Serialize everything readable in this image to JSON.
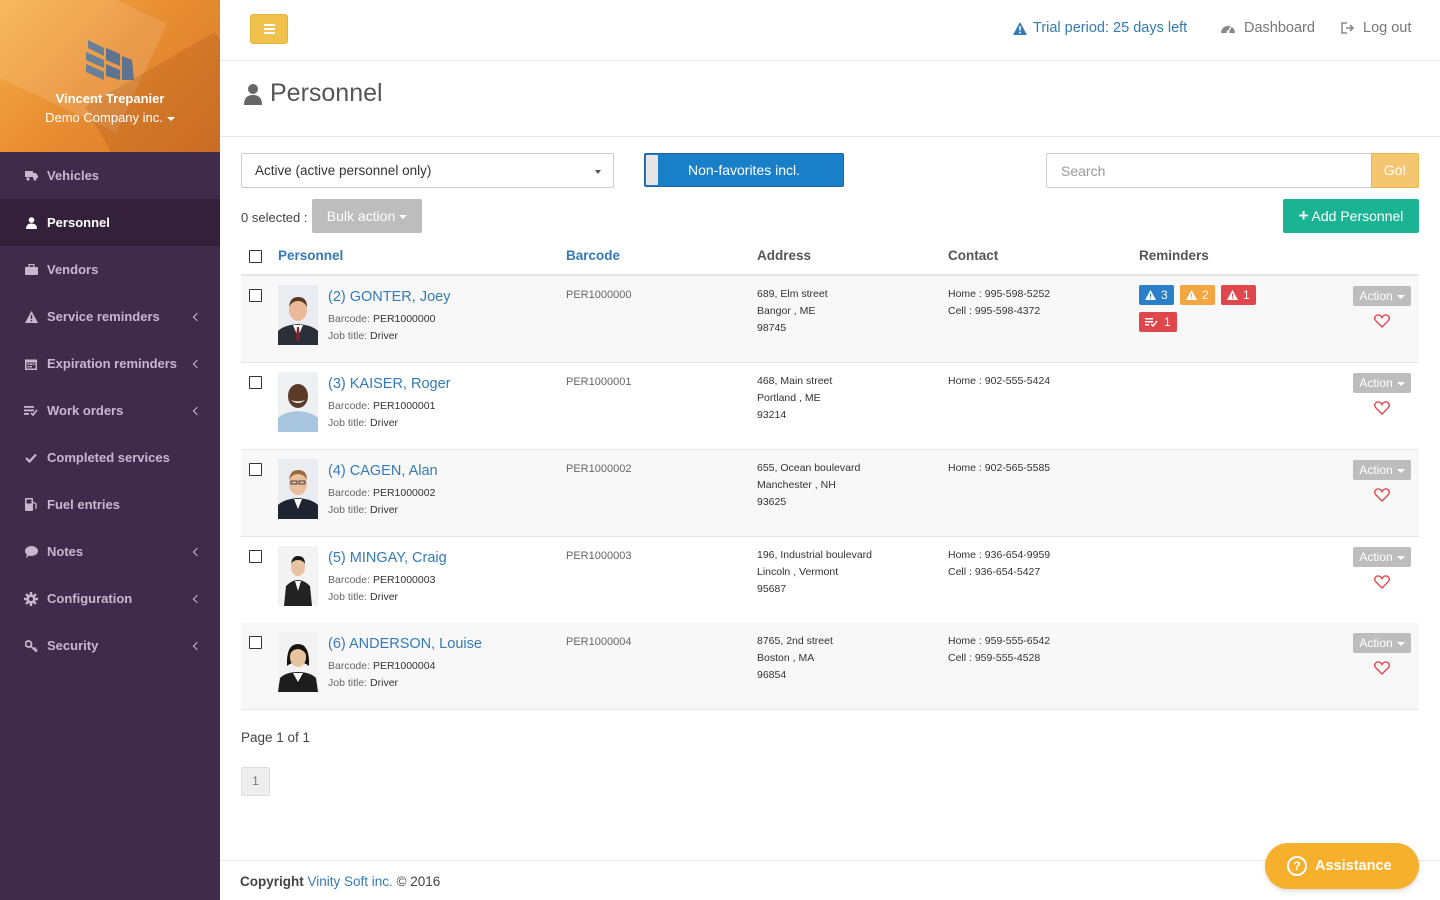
{
  "sidebar": {
    "user_name": "Vincent Trepanier",
    "company": "Demo Company inc.",
    "items": [
      {
        "label": "Vehicles",
        "icon": "truck-icon"
      },
      {
        "label": "Personnel",
        "icon": "user-icon"
      },
      {
        "label": "Vendors",
        "icon": "briefcase-icon"
      },
      {
        "label": "Service reminders",
        "icon": "warning-icon"
      },
      {
        "label": "Expiration reminders",
        "icon": "calendar-icon"
      },
      {
        "label": "Work orders",
        "icon": "list-icon"
      },
      {
        "label": "Completed services",
        "icon": "check-icon"
      },
      {
        "label": "Fuel entries",
        "icon": "fuel-icon"
      },
      {
        "label": "Notes",
        "icon": "comment-icon"
      },
      {
        "label": "Configuration",
        "icon": "gear-icon"
      },
      {
        "label": "Security",
        "icon": "key-icon"
      }
    ]
  },
  "topbar": {
    "trial": "Trial period: 25 days left",
    "dashboard": "Dashboard",
    "logout": "Log out"
  },
  "page": {
    "title": "Personnel"
  },
  "filters": {
    "status_select": "Active (active personnel only)",
    "favorites_toggle": "Non-favorites incl.",
    "search_placeholder": "Search",
    "go_label": "Go!",
    "selected_text": "0 selected :",
    "bulk_action": "Bulk action",
    "add_personnel": "Add Personnel"
  },
  "table": {
    "headers": [
      "Personnel",
      "Barcode",
      "Address",
      "Contact",
      "Reminders"
    ],
    "barcode_label": "Barcode:",
    "job_label": "Job title:",
    "action_label": "Action",
    "rows": [
      {
        "name": "(2) GONTER, Joey",
        "barcode": "PER1000000",
        "job": "Driver",
        "address": [
          "689, Elm street",
          "Bangor , ME",
          "98745"
        ],
        "contact": [
          "Home : 995-598-5252",
          "Cell : 995-598-4372"
        ],
        "reminders": [
          "3",
          "2",
          "1",
          "1"
        ]
      },
      {
        "name": "(3) KAISER, Roger",
        "barcode": "PER1000001",
        "job": "Driver",
        "address": [
          "468, Main street",
          "Portland , ME",
          "93214"
        ],
        "contact": [
          "Home : 902-555-5424"
        ],
        "reminders": []
      },
      {
        "name": "(4) CAGEN, Alan",
        "barcode": "PER1000002",
        "job": "Driver",
        "address": [
          "655, Ocean boulevard",
          "Manchester , NH",
          "93625"
        ],
        "contact": [
          "Home : 902-565-5585"
        ],
        "reminders": []
      },
      {
        "name": "(5) MINGAY, Craig",
        "barcode": "PER1000003",
        "job": "Driver",
        "address": [
          "196, Industrial boulevard",
          "Lincoln , Vermont",
          "95687"
        ],
        "contact": [
          "Home : 936-654-9959",
          "Cell : 936-654-5427"
        ],
        "reminders": []
      },
      {
        "name": "(6) ANDERSON, Louise",
        "barcode": "PER1000004",
        "job": "Driver",
        "address": [
          "8765, 2nd street",
          "Boston , MA",
          "96854"
        ],
        "contact": [
          "Home : 959-555-6542",
          "Cell : 959-555-4528"
        ],
        "reminders": []
      }
    ]
  },
  "pagination": {
    "info": "Page 1 of 1",
    "current": "1"
  },
  "footer": {
    "copyright": "Copyright",
    "company_link": "Vinity Soft inc.",
    "year": "© 2016"
  },
  "assistance": "Assistance",
  "colors": {
    "sidebar_bg": "#3f2b4a",
    "accent_blue": "#337ab7",
    "add_green": "#1ab394",
    "badge_blue": "#2a7fc9",
    "badge_orange": "#f4a641",
    "badge_red": "#e0474d",
    "assistance": "#f6b02c"
  }
}
